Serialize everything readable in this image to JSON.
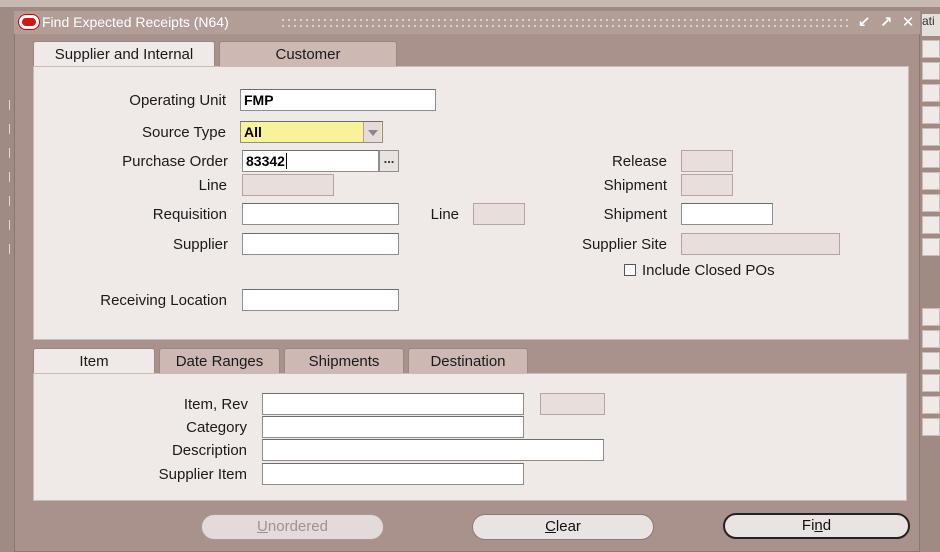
{
  "window": {
    "title": "Find Expected Receipts (N64)",
    "controls": [
      "↙",
      "↗",
      "✕"
    ]
  },
  "background_fragment": "ati",
  "top_tabs": [
    {
      "label": "Supplier and Internal",
      "active": true
    },
    {
      "label": "Customer",
      "active": false
    }
  ],
  "header_form": {
    "operating_unit": {
      "label": "Operating Unit",
      "value": "FMP"
    },
    "source_type": {
      "label": "Source Type",
      "value": "All"
    },
    "purchase_order": {
      "label": "Purchase Order",
      "value": "83342",
      "lov": "..."
    },
    "release": {
      "label": "Release",
      "value": ""
    },
    "po_line": {
      "label": "Line",
      "value": ""
    },
    "po_shipment": {
      "label": "Shipment",
      "value": ""
    },
    "requisition": {
      "label": "Requisition",
      "value": ""
    },
    "req_line": {
      "label": "Line",
      "value": ""
    },
    "req_shipment": {
      "label": "Shipment",
      "value": ""
    },
    "supplier": {
      "label": "Supplier",
      "value": ""
    },
    "supplier_site": {
      "label": "Supplier Site",
      "value": ""
    },
    "include_closed_pos": {
      "label": "Include Closed POs",
      "checked": false
    },
    "receiving_location": {
      "label": "Receiving Location",
      "value": ""
    }
  },
  "detail_tabs": [
    {
      "label": "Item",
      "active": true
    },
    {
      "label": "Date Ranges",
      "active": false
    },
    {
      "label": "Shipments",
      "active": false
    },
    {
      "label": "Destination",
      "active": false
    }
  ],
  "item_form": {
    "item_rev": {
      "label": "Item, Rev",
      "value": "",
      "rev": ""
    },
    "category": {
      "label": "Category",
      "value": ""
    },
    "description": {
      "label": "Description",
      "value": ""
    },
    "supplier_item": {
      "label": "Supplier Item",
      "value": ""
    }
  },
  "buttons": {
    "unordered": {
      "label": "Unordered",
      "mnemonic": "U",
      "rest": "nordered"
    },
    "clear": {
      "label": "Clear",
      "mnemonic": "C",
      "rest": "lear"
    },
    "find": {
      "label": "Find",
      "pre": "Fi",
      "mnemonic": "n",
      "rest": "d"
    }
  }
}
